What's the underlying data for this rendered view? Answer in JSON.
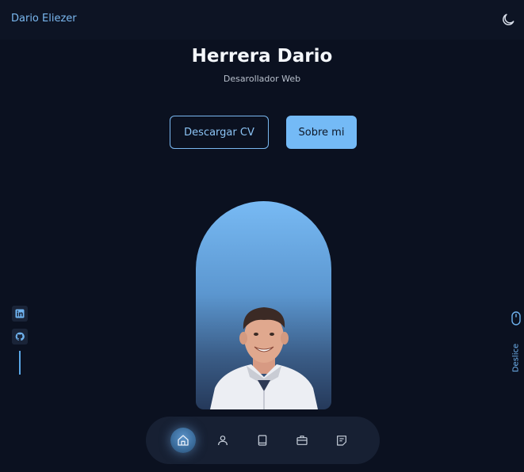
{
  "header": {
    "brand": "Dario Eliezer",
    "theme_icon": "moon-icon"
  },
  "hero": {
    "title": "Herrera Dario",
    "subtitle": "Desarollador Web",
    "primary_button": "Descargar CV",
    "secondary_button": "Sobre mi"
  },
  "socials": [
    {
      "icon": "linkedin-icon"
    },
    {
      "icon": "github-icon"
    }
  ],
  "scroll": {
    "label": "Deslice",
    "icon": "mouse-icon"
  },
  "nav": {
    "items": [
      {
        "icon": "home-icon",
        "active": true
      },
      {
        "icon": "user-icon",
        "active": false
      },
      {
        "icon": "book-icon",
        "active": false
      },
      {
        "icon": "briefcase-icon",
        "active": false
      },
      {
        "icon": "message-icon",
        "active": false
      }
    ]
  },
  "colors": {
    "background": "#0b1120",
    "accent": "#74baf6",
    "nav_background": "#172033"
  }
}
